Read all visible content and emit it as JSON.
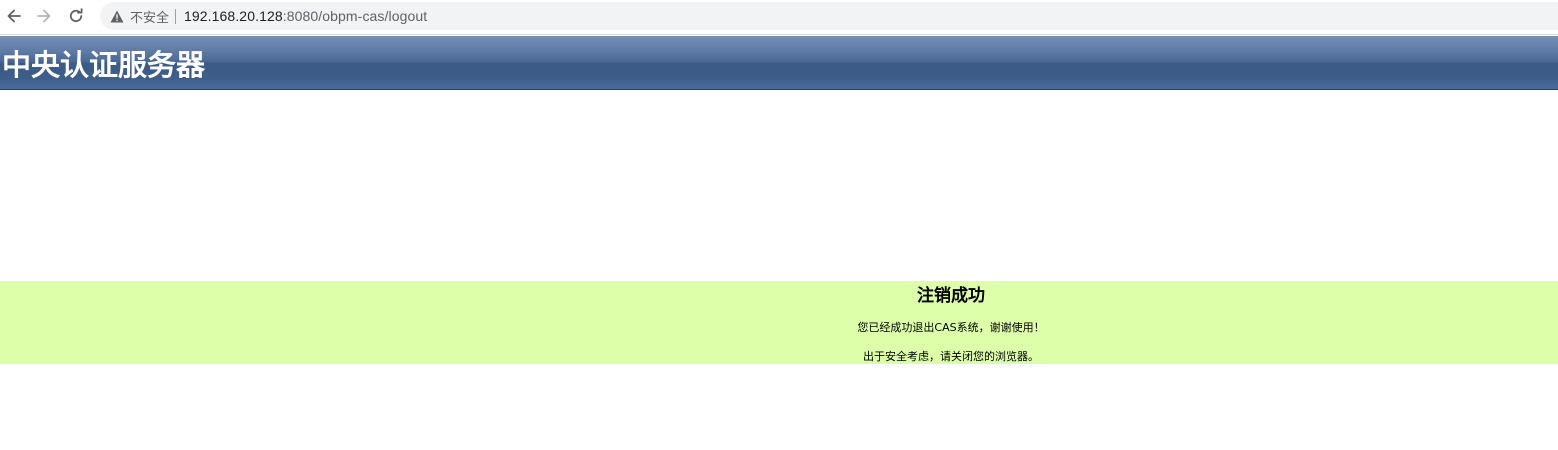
{
  "browser": {
    "security_label": "不安全",
    "url_host": "192.168.20.128",
    "url_rest": ":8080/obpm-cas/logout",
    "icons": {
      "back": "back-arrow-icon",
      "forward": "forward-arrow-icon",
      "reload": "reload-icon",
      "warning": "warning-triangle-icon"
    }
  },
  "header": {
    "title": "中央认证服务器",
    "gradient_top": "#7690b6",
    "gradient_bottom": "#3b5b86"
  },
  "logout": {
    "title": "注销成功",
    "message_1": "您已经成功退出CAS系统，谢谢使用！",
    "message_2": "出于安全考虑，请关闭您的浏览器。",
    "background": "#ddffaa"
  }
}
